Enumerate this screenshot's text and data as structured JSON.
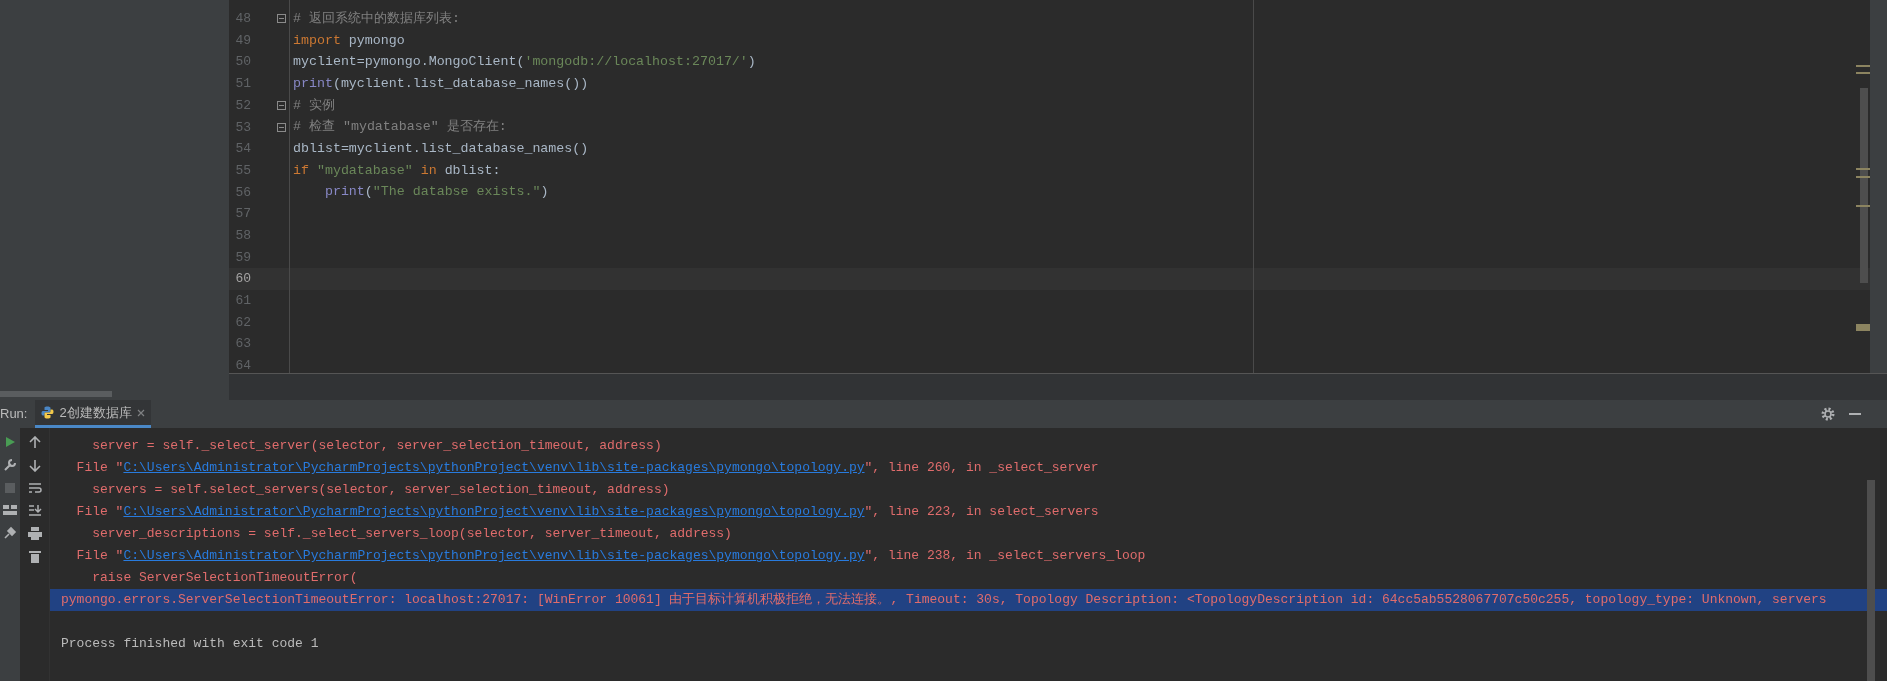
{
  "editor": {
    "lines": [
      {
        "number": "48",
        "fold": true,
        "current": false,
        "tokens": [
          {
            "kind": "comment",
            "text": "# 返回系统中的数据库列表:"
          }
        ]
      },
      {
        "number": "49",
        "fold": false,
        "current": false,
        "tokens": [
          {
            "kind": "keyword",
            "text": "import"
          },
          {
            "kind": "plain",
            "text": " pymongo"
          }
        ]
      },
      {
        "number": "50",
        "fold": false,
        "current": false,
        "tokens": [
          {
            "kind": "plain",
            "text": "myclient=pymongo.MongoClient("
          },
          {
            "kind": "string",
            "text": "'mongodb://localhost:27017/'"
          },
          {
            "kind": "plain",
            "text": ")"
          }
        ]
      },
      {
        "number": "51",
        "fold": false,
        "current": false,
        "tokens": [
          {
            "kind": "builtin",
            "text": "print"
          },
          {
            "kind": "plain",
            "text": "(myclient.list_database_names())"
          }
        ]
      },
      {
        "number": "52",
        "fold": true,
        "current": false,
        "tokens": [
          {
            "kind": "comment",
            "text": "# 实例"
          }
        ]
      },
      {
        "number": "53",
        "fold": true,
        "current": false,
        "tokens": [
          {
            "kind": "comment",
            "text": "# 检查 \"mydatabase\" 是否存在:"
          }
        ]
      },
      {
        "number": "54",
        "fold": false,
        "current": false,
        "tokens": [
          {
            "kind": "plain",
            "text": "dblist=myclient.list_database_names()"
          }
        ]
      },
      {
        "number": "55",
        "fold": false,
        "current": false,
        "tokens": [
          {
            "kind": "keyword",
            "text": "if "
          },
          {
            "kind": "string",
            "text": "\"mydatabase\" "
          },
          {
            "kind": "keyword",
            "text": "in"
          },
          {
            "kind": "plain",
            "text": " dblist:"
          }
        ]
      },
      {
        "number": "56",
        "fold": false,
        "current": false,
        "tokens": [
          {
            "kind": "builtin",
            "text": "    print"
          },
          {
            "kind": "plain",
            "text": "("
          },
          {
            "kind": "string",
            "text": "\"The databse exists.\""
          },
          {
            "kind": "plain",
            "text": ")"
          }
        ]
      },
      {
        "number": "57",
        "fold": false,
        "current": false
      },
      {
        "number": "58",
        "fold": false,
        "current": false
      },
      {
        "number": "59",
        "fold": false,
        "current": false
      },
      {
        "number": "60",
        "fold": false,
        "current": true
      },
      {
        "number": "61",
        "fold": false,
        "current": false
      },
      {
        "number": "62",
        "fold": false,
        "current": false
      },
      {
        "number": "63",
        "fold": false,
        "current": false
      },
      {
        "number": "64",
        "fold": false,
        "current": false
      }
    ]
  },
  "run_panel": {
    "label": "Run:",
    "tabs": [
      {
        "label": "2创建数据库",
        "selected": true
      }
    ],
    "console": [
      {
        "kind": "error",
        "selected": false,
        "tokens": [
          {
            "kind": "text",
            "text": "    server = self._select_server(selector, server_selection_timeout, address)"
          }
        ]
      },
      {
        "kind": "error",
        "selected": false,
        "tokens": [
          {
            "kind": "text",
            "text": "  File \""
          },
          {
            "kind": "link",
            "text": "C:\\Users\\Administrator\\PycharmProjects\\pythonProject\\venv\\lib\\site-packages\\pymongo\\topology.py"
          },
          {
            "kind": "text",
            "text": "\", line 260, in _select_server"
          }
        ]
      },
      {
        "kind": "error",
        "selected": false,
        "tokens": [
          {
            "kind": "text",
            "text": "    servers = self.select_servers(selector, server_selection_timeout, address)"
          }
        ]
      },
      {
        "kind": "error",
        "selected": false,
        "tokens": [
          {
            "kind": "text",
            "text": "  File \""
          },
          {
            "kind": "link",
            "text": "C:\\Users\\Administrator\\PycharmProjects\\pythonProject\\venv\\lib\\site-packages\\pymongo\\topology.py"
          },
          {
            "kind": "text",
            "text": "\", line 223, in select_servers"
          }
        ]
      },
      {
        "kind": "error",
        "selected": false,
        "tokens": [
          {
            "kind": "text",
            "text": "    server_descriptions = self._select_servers_loop(selector, server_timeout, address)"
          }
        ]
      },
      {
        "kind": "error",
        "selected": false,
        "tokens": [
          {
            "kind": "text",
            "text": "  File \""
          },
          {
            "kind": "link",
            "text": "C:\\Users\\Administrator\\PycharmProjects\\pythonProject\\venv\\lib\\site-packages\\pymongo\\topology.py"
          },
          {
            "kind": "text",
            "text": "\", line 238, in _select_servers_loop"
          }
        ]
      },
      {
        "kind": "error",
        "selected": false,
        "tokens": [
          {
            "kind": "text",
            "text": "    raise ServerSelectionTimeoutError("
          }
        ]
      },
      {
        "kind": "error",
        "selected": true,
        "tokens": [
          {
            "kind": "text",
            "text": "pymongo.errors.ServerSelectionTimeoutError: localhost:27017: [WinError 10061] 由于目标计算机积极拒绝，无法连接。, Timeout: 30s, Topology Description: <TopologyDescription id: 64cc5ab5528067707c50c255, topology_type: Unknown, servers"
          }
        ]
      },
      {
        "kind": "blank",
        "selected": false
      },
      {
        "kind": "normal",
        "selected": false,
        "tokens": [
          {
            "kind": "text",
            "text": "Process finished with exit code 1"
          }
        ]
      }
    ]
  }
}
